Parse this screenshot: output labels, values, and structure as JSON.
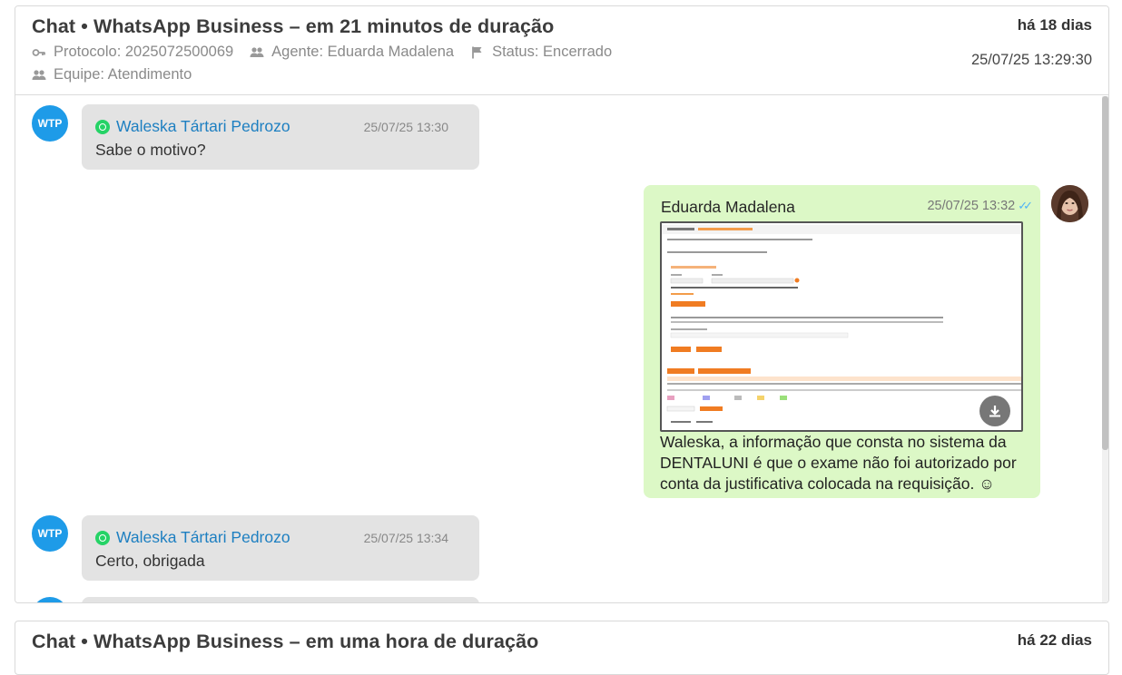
{
  "chat1": {
    "title": "Chat • WhatsApp Business – em 21 minutos de duração",
    "ago": "há 18 dias",
    "datetime": "25/07/25 13:29:30",
    "protocol": "Protocolo: 2025072500069",
    "agent": "Agente: Eduarda Madalena",
    "status": "Status: Encerrado",
    "team": "Equipe: Atendimento",
    "messages": [
      {
        "avatar": "WTP",
        "sender": "Waleska Tártari Pedrozo",
        "time": "25/07/25 13:30",
        "text": "Sabe o motivo?"
      },
      {
        "sender": "Eduarda Madalena",
        "time": "25/07/25 13:32",
        "ticks": "✓✓",
        "text": "Waleska, a informação que consta no sistema da DENTALUNI é que o exame não foi autorizado por conta da justificativa colocada na requisição. ☺"
      },
      {
        "avatar": "WTP",
        "sender": "Waleska Tártari Pedrozo",
        "time": "25/07/25 13:34",
        "text": "Certo, obrigada"
      }
    ]
  },
  "chat2": {
    "title": "Chat • WhatsApp Business – em uma hora de duração",
    "ago": "há 22 dias"
  },
  "icons": {
    "protocol": "key-icon",
    "agent": "users-icon",
    "status": "flag-icon",
    "team": "users-icon",
    "channel": "whatsapp-icon",
    "download": "download-icon"
  },
  "colors": {
    "avatar_bg": "#1e9be8",
    "incoming_bubble": "#e3e3e3",
    "outgoing_bubble": "#dcf8c6",
    "sender_link": "#1d7fc1",
    "whatsapp": "#25d366",
    "read_ticks": "#4fb3f6"
  }
}
